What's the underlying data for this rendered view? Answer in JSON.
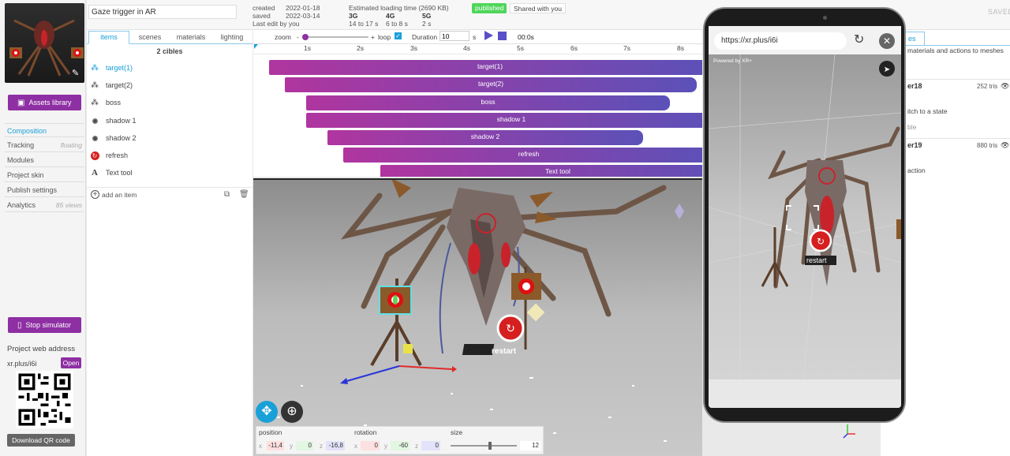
{
  "left": {
    "nav": [
      {
        "label": "Composition",
        "active": true
      },
      {
        "label": "Tracking",
        "note": "floating"
      },
      {
        "label": "Modules"
      },
      {
        "label": "Project skin"
      },
      {
        "label": "Publish settings"
      },
      {
        "label": "Analytics",
        "note": "85 views"
      }
    ],
    "assets_label": "Assets library",
    "stop_label": "Stop simulator",
    "web_address_title": "Project web address",
    "web_address": "xr.plus/i6i",
    "open_label": "Open",
    "download_label": "Download QR code"
  },
  "header": {
    "title": "Gaze trigger in AR",
    "created_label": "created",
    "created": "2022-01-18",
    "saved_label": "saved",
    "saved": "2022-03-14",
    "last_edit": "Last edit by you",
    "loading_title": "Estimated loading time (2690 KB)",
    "net": [
      {
        "name": "3G",
        "time": "14 to 17 s"
      },
      {
        "name": "4G",
        "time": "6 to 8 s"
      },
      {
        "name": "5G",
        "time": "2 s"
      }
    ],
    "published": "published",
    "shared": "Shared with you",
    "saved_status": "SAVED"
  },
  "tabs": [
    "items",
    "scenes",
    "materials",
    "lighting"
  ],
  "items_panel": {
    "cibles": "2 cibles",
    "list": [
      {
        "label": "target(1)",
        "icon": "cubes-icon",
        "active": true
      },
      {
        "label": "target(2)",
        "icon": "cubes-icon"
      },
      {
        "label": "boss",
        "icon": "cubes-icon"
      },
      {
        "label": "shadow 1",
        "icon": "shadow-icon"
      },
      {
        "label": "shadow 2",
        "icon": "shadow-icon"
      },
      {
        "label": "refresh",
        "icon": "refresh-icon"
      },
      {
        "label": "Text tool",
        "icon": "text-icon"
      }
    ],
    "add_label": "add an item"
  },
  "timeline_controls": {
    "zoom_label": "zoom",
    "minus": "-",
    "plus": "+",
    "loop_label": "loop",
    "duration_label": "Duration",
    "duration": "10",
    "unit": "s",
    "time": "00:0s"
  },
  "timeline": {
    "ticks": [
      "1s",
      "2s",
      "3s",
      "4s",
      "5s",
      "6s",
      "7s",
      "8s"
    ],
    "bars": [
      {
        "label": "target(1)"
      },
      {
        "label": "target(2)"
      },
      {
        "label": "boss"
      },
      {
        "label": "shadow 1"
      },
      {
        "label": "shadow 2"
      },
      {
        "label": "refresh"
      },
      {
        "label": "Text tool"
      }
    ]
  },
  "transform": {
    "position_label": "position",
    "rotation_label": "rotation",
    "size_label": "size",
    "x": "x",
    "y": "y",
    "z": "z",
    "pos": [
      "-11,4",
      "0",
      "-16,8"
    ],
    "rot": [
      "0",
      "-60",
      "0"
    ],
    "size": "12"
  },
  "viewport": {
    "restart_label": "restart"
  },
  "right_panel": {
    "tab": "es",
    "hint": "materials and actions to meshes",
    "rows": [
      {
        "name": "er18",
        "tris": "252 tris",
        "sub": "itch to a state",
        "sub2": "ble"
      },
      {
        "name": "er19",
        "tris": "880 tris",
        "sub": "action"
      }
    ]
  },
  "phone": {
    "url": "https://xr.plus/i6i",
    "powered": "Powered by XR+",
    "restart_label": "restart"
  },
  "colors": {
    "accent": "#8e2fa3",
    "blue": "#1aa0d8",
    "green": "#5cd65c"
  }
}
